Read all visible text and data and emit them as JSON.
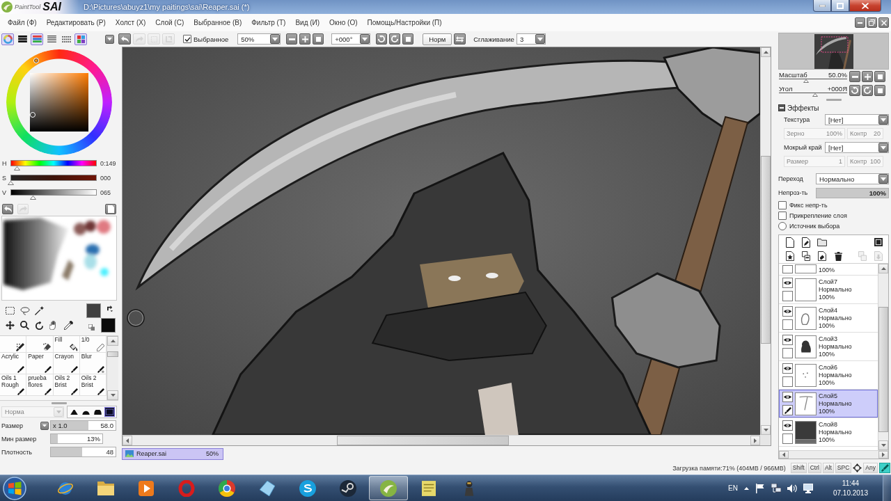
{
  "window": {
    "logo": {
      "caption": "PaintTool",
      "wordmark": "SAI"
    },
    "title": "D:\\Pictures\\abuyz1\\my paitings\\sai\\Reaper.sai (*)"
  },
  "menu": [
    "Файл (Ф)",
    "Редактировать (Р)",
    "Холст (Х)",
    "Слой (С)",
    "Выбранное (В)",
    "Фильтр (Т)",
    "Вид (И)",
    "Окно (О)",
    "Помощь/Настройки (П)"
  ],
  "toolbar": {
    "actions": [
      {
        "kind": "undo",
        "disabled": false
      },
      {
        "kind": "redo",
        "disabled": true
      },
      {
        "kind": "deselect",
        "disabled": true
      },
      {
        "kind": "crop",
        "disabled": true
      }
    ],
    "selection": {
      "label": "Выбранное",
      "checked": true
    },
    "zoom": "50%",
    "angle": "+000°",
    "view_mode": "Норм",
    "smoothing": {
      "label": "Сглаживание",
      "value": "3"
    }
  },
  "color_panel": {
    "views": [
      {
        "kind": "wheel",
        "on": true
      },
      {
        "kind": "rgb",
        "on": false
      },
      {
        "kind": "hsv",
        "on": true
      },
      {
        "kind": "list",
        "on": false
      },
      {
        "kind": "grid",
        "on": false
      },
      {
        "kind": "swatches",
        "on": true
      }
    ],
    "sliders": [
      {
        "channel": "H",
        "level": 0.08,
        "reading": "0:149"
      },
      {
        "channel": "S",
        "level": 0,
        "reading": "000"
      },
      {
        "channel": "V",
        "level": 0.26,
        "reading": "065"
      }
    ],
    "swatches": [
      {
        "color": "#414141"
      },
      {
        "color": "#0b0b0b"
      }
    ]
  },
  "scratchpad": {
    "actions": [
      {
        "kind": "undo",
        "disabled": false
      },
      {
        "kind": "redo",
        "disabled": true
      },
      {
        "kind": "clear",
        "disabled": false
      }
    ]
  },
  "brushes": {
    "items": [
      {
        "kind": "select-pen"
      },
      {
        "kind": "select-eraser"
      },
      {
        "kind": "bucket",
        "label": "Fill"
      },
      {
        "kind": "pencil",
        "label": "1/0"
      },
      {
        "kind": "pen",
        "label": "Acrylic"
      },
      {
        "kind": "pen",
        "label": "Paper"
      },
      {
        "kind": "pen",
        "label": "Crayon"
      },
      {
        "kind": "blur",
        "label": "Blur"
      },
      {
        "kind": "pen",
        "label": "Oils 1 Rough"
      },
      {
        "kind": "pen",
        "label": "prueba flores"
      },
      {
        "kind": "pen",
        "label": "Oils 2 Brist"
      },
      {
        "kind": "pen",
        "label": "Oils 2 Brist"
      }
    ],
    "blend": {
      "value": "Норма",
      "disabled": true
    },
    "tips": [
      {
        "kind": "peak",
        "selected": false
      },
      {
        "kind": "dome",
        "selected": false
      },
      {
        "kind": "flat",
        "selected": false
      },
      {
        "kind": "square",
        "selected": true
      }
    ],
    "params": [
      {
        "label": "Размер",
        "multiplier": "x 1.0",
        "value": "58.0",
        "level": 0.58
      },
      {
        "label": "Мин размер",
        "value": "13%",
        "level": 0.13
      },
      {
        "label": "Плотность",
        "value": "48",
        "level": 0.48
      }
    ]
  },
  "documents": [
    {
      "name": "Reaper.sai",
      "zoom": "50%",
      "selected": true
    }
  ],
  "navigator": {
    "zoom": {
      "label": "Масштаб",
      "value": "50.0%",
      "level": 0.4
    },
    "angle": {
      "label": "Угол",
      "value": "+000Я",
      "level": 0.53
    }
  },
  "effects": {
    "title": "Эффекты",
    "expanded": true,
    "rows": [
      {
        "kind": "select",
        "label": "Текстура",
        "value": "[Нет]"
      },
      {
        "kind": "params",
        "params": [
          {
            "label": "Зерно",
            "value": "100%",
            "disabled": true
          },
          {
            "label": "Контр",
            "value": "20",
            "disabled": true
          }
        ]
      },
      {
        "kind": "select",
        "label": "Мокрый край",
        "value": "[Нет]"
      },
      {
        "kind": "params",
        "params": [
          {
            "label": "Размер",
            "value": "1",
            "disabled": true
          },
          {
            "label": "Контр",
            "value": "100",
            "disabled": true
          }
        ]
      }
    ]
  },
  "layer_props": {
    "blend": {
      "label": "Переход",
      "value": "Нормально"
    },
    "opacity": {
      "label": "Непроз-ть",
      "value": "100%",
      "level": 1
    },
    "options": [
      {
        "kind": "checkbox",
        "label": "Фикс непр-ть",
        "checked": false
      },
      {
        "kind": "checkbox",
        "label": "Прикрепление слоя",
        "checked": false
      },
      {
        "kind": "radio",
        "label": "Источник выбора",
        "checked": false
      }
    ]
  },
  "layers": {
    "tools": [
      {
        "left": [
          {
            "kind": "new-layer",
            "disabled": false
          },
          {
            "kind": "new-vector-layer",
            "disabled": false
          },
          {
            "kind": "new-folder",
            "disabled": false
          }
        ],
        "right": [
          {
            "kind": "mask",
            "disabled": false
          }
        ]
      },
      {
        "left": [
          {
            "kind": "transfer-down",
            "disabled": false
          },
          {
            "kind": "merge-down",
            "disabled": false
          },
          {
            "kind": "clear",
            "disabled": false
          },
          {
            "kind": "delete",
            "disabled": false
          }
        ],
        "right": [
          {
            "kind": "merge-group",
            "disabled": true
          },
          {
            "kind": "copy-down",
            "disabled": true
          }
        ]
      }
    ],
    "cut_off": {
      "opacity": "100%"
    },
    "items": [
      {
        "name": "Слой7",
        "mode": "Нормально",
        "opacity": "100%",
        "visible": true,
        "selected": false,
        "kind": "blank"
      },
      {
        "name": "Слой4",
        "mode": "Нормально",
        "opacity": "100%",
        "visible": true,
        "selected": false,
        "kind": "sketch"
      },
      {
        "name": "Слой3",
        "mode": "Нормально",
        "opacity": "100%",
        "visible": true,
        "selected": false,
        "kind": "figure"
      },
      {
        "name": "Слой6",
        "mode": "Нормально",
        "opacity": "100%",
        "visible": true,
        "selected": false,
        "kind": "dots"
      },
      {
        "name": "Слой5",
        "mode": "Нормально",
        "opacity": "100%",
        "visible": true,
        "selected": true,
        "kind": "stroke"
      },
      {
        "name": "Слой8",
        "mode": "Нормально",
        "opacity": "100%",
        "visible": true,
        "selected": false,
        "kind": "fill"
      }
    ]
  },
  "status_bar": {
    "memory": "Загрузка памяти:71% (404MB / 966MB)",
    "keys": [
      "Shift",
      "Ctrl",
      "Alt",
      "SPC"
    ],
    "any": "Any"
  },
  "taskbar": {
    "apps": [
      {
        "kind": "globe",
        "active": false
      },
      {
        "kind": "folder",
        "active": false
      },
      {
        "kind": "player",
        "active": false
      },
      {
        "kind": "ring",
        "active": false
      },
      {
        "kind": "wheel",
        "active": false
      },
      {
        "kind": "crystal",
        "active": false
      },
      {
        "kind": "chat",
        "active": false
      },
      {
        "kind": "gear",
        "active": false
      },
      {
        "kind": "brush",
        "active": true
      },
      {
        "kind": "note",
        "active": false
      },
      {
        "kind": "figure",
        "active": false
      }
    ],
    "language": "EN",
    "time": "11:44",
    "date": "07.10.2013"
  }
}
